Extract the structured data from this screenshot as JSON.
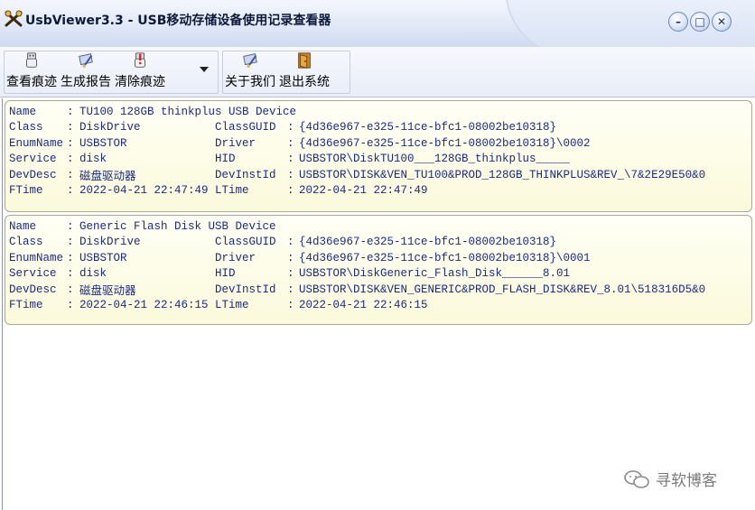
{
  "window": {
    "title": "UsbViewer3.3 - USB移动存储设备使用记录查看器",
    "minimize": "–",
    "restore": "□",
    "close": "✕"
  },
  "toolbar": {
    "view_traces": "查看痕迹",
    "generate_report": "生成报告",
    "clear_traces": "清除痕迹",
    "about_us": "关于我们",
    "exit_system": "退出系统"
  },
  "devices": [
    {
      "name_key": "Name",
      "name_sep": ":",
      "name_val": "TU100 128GB thinkplus USB Device",
      "rows": [
        {
          "k1": "Class",
          "v1": "DiskDrive",
          "k2": "ClassGUID",
          "v2": "{4d36e967-e325-11ce-bfc1-08002be10318}"
        },
        {
          "k1": "EnumName",
          "v1": "USBSTOR",
          "k2": "Driver",
          "v2": "{4d36e967-e325-11ce-bfc1-08002be10318}\\0002"
        },
        {
          "k1": "Service",
          "v1": "disk",
          "k2": "HID",
          "v2": "USBSTOR\\DiskTU100___128GB_thinkplus_____"
        },
        {
          "k1": "DevDesc",
          "v1": "磁盘驱动器",
          "k2": "DevInstId",
          "v2": "USBSTOR\\DISK&VEN_TU100&PROD_128GB_THINKPLUS&REV_\\7&2E29E50&0"
        },
        {
          "k1": "FTime",
          "v1": "2022-04-21 22:47:49",
          "k2": "LTime",
          "v2": "2022-04-21 22:47:49"
        }
      ]
    },
    {
      "name_key": "Name",
      "name_sep": ":",
      "name_val": "Generic Flash Disk USB Device",
      "rows": [
        {
          "k1": "Class",
          "v1": "DiskDrive",
          "k2": "ClassGUID",
          "v2": "{4d36e967-e325-11ce-bfc1-08002be10318}"
        },
        {
          "k1": "EnumName",
          "v1": "USBSTOR",
          "k2": "Driver",
          "v2": "{4d36e967-e325-11ce-bfc1-08002be10318}\\0001"
        },
        {
          "k1": "Service",
          "v1": "disk",
          "k2": "HID",
          "v2": "USBSTOR\\DiskGeneric_Flash_Disk______8.01"
        },
        {
          "k1": "DevDesc",
          "v1": "磁盘驱动器",
          "k2": "DevInstId",
          "v2": "USBSTOR\\DISK&VEN_GENERIC&PROD_FLASH_DISK&REV_8.01\\518316D5&0"
        },
        {
          "k1": "FTime",
          "v1": "2022-04-21 22:46:15",
          "k2": "LTime",
          "v2": "2022-04-21 22:46:15"
        }
      ]
    }
  ],
  "watermark": {
    "text": "寻软博客"
  },
  "icons": [
    "app-icon",
    "usb-drive-icon",
    "report-icon",
    "clear-icon",
    "about-icon",
    "exit-icon",
    "wechat-icon"
  ],
  "colors": {
    "text": "#1a2a8a",
    "card_bg": "#fbfadb",
    "card_border": "#a9a890",
    "titlebar": "#dfe7f6"
  }
}
